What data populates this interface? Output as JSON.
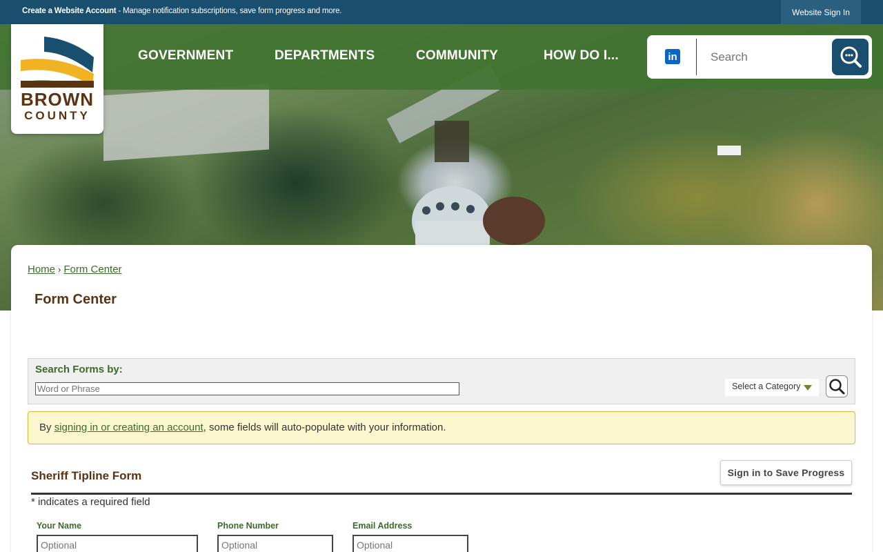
{
  "topbar": {
    "create_label": "Create a Website Account",
    "create_text": " - Manage notification subscriptions, save form progress and more.",
    "signin_label": "Website Sign In"
  },
  "logo": {
    "line1": "BROWN",
    "line2": "COUNTY"
  },
  "nav": {
    "items": [
      {
        "label": "GOVERNMENT"
      },
      {
        "label": "DEPARTMENTS"
      },
      {
        "label": "COMMUNITY"
      },
      {
        "label": "HOW DO I..."
      }
    ]
  },
  "search": {
    "placeholder": "Search",
    "social_icon": "linkedin-icon",
    "button_icon": "search-icon"
  },
  "breadcrumb": {
    "home": "Home",
    "separator": "›",
    "current": "Form Center"
  },
  "page": {
    "title": "Form Center"
  },
  "search_forms": {
    "label": "Search Forms by:",
    "input_placeholder": "Word or Phrase",
    "category_label": "Select a Category"
  },
  "notice": {
    "prefix": "By ",
    "link": "signing in or creating an account",
    "suffix": ", some fields will auto-populate with your information."
  },
  "form": {
    "title": "Sheriff Tipline Form",
    "save_label": "Sign in to Save Progress",
    "required_note": "* indicates a required field",
    "fields": [
      {
        "label": "Your Name",
        "placeholder": "Optional"
      },
      {
        "label": "Phone Number",
        "placeholder": "Optional"
      },
      {
        "label": "Email Address",
        "placeholder": "Optional"
      }
    ]
  },
  "colors": {
    "topbar": "#1a4e6e",
    "nav_green": "#427330",
    "accent_green": "#3b6b2a",
    "brown": "#5a3312",
    "notice_bg": "#fdf7cf"
  }
}
